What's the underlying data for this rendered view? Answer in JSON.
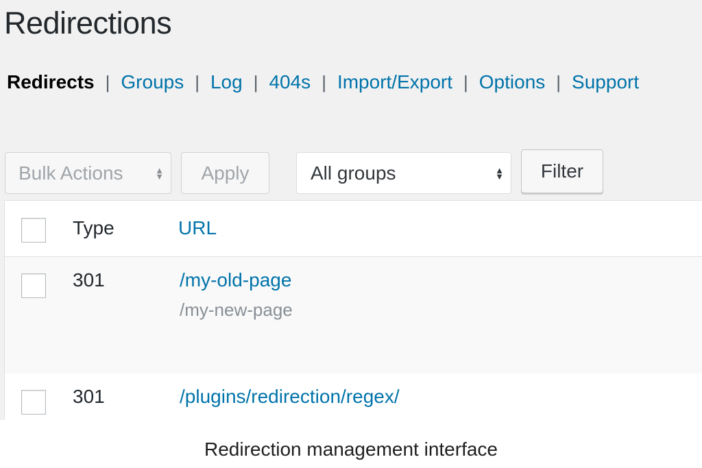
{
  "page": {
    "title": "Redirections"
  },
  "subnav": {
    "items": [
      {
        "label": "Redirects"
      },
      {
        "label": "Groups"
      },
      {
        "label": "Log"
      },
      {
        "label": "404s"
      },
      {
        "label": "Import/Export"
      },
      {
        "label": "Options"
      },
      {
        "label": "Support"
      }
    ],
    "separator": "|"
  },
  "toolbar": {
    "bulk_actions": "Bulk Actions",
    "apply_label": "Apply",
    "group_select": "All groups",
    "filter_label": "Filter"
  },
  "table": {
    "headers": {
      "type": "Type",
      "url": "URL"
    },
    "rows": [
      {
        "type": "301",
        "source": "/my-old-page",
        "target": "/my-new-page"
      },
      {
        "type": "301",
        "source": "/plugins/redirection/regex/"
      }
    ]
  },
  "caption": "Redirection management interface"
}
